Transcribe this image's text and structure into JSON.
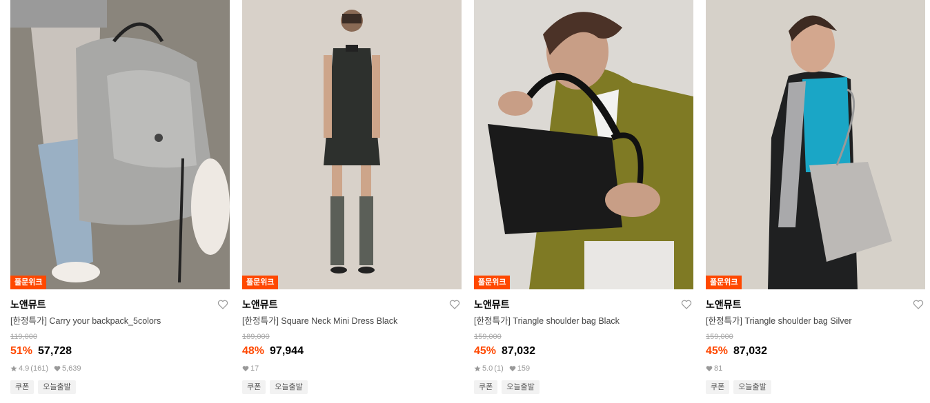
{
  "colors": {
    "accent": "#ff4800",
    "badge_bg": "#ff4800",
    "tag_bg": "#f2f2f2"
  },
  "products": [
    {
      "image_alt": "backpack photo",
      "badge": "풀문위크",
      "brand": "노앤뮤트",
      "name": "[한정특가] Carry your backpack_5colors",
      "original_price": "119,000",
      "discount": "51%",
      "price": "57,728",
      "rating": "4.9",
      "review_count": "(161)",
      "likes": "5,639",
      "tags": [
        "쿠폰",
        "오늘출발"
      ]
    },
    {
      "image_alt": "dress photo",
      "badge": "풀문위크",
      "brand": "노앤뮤트",
      "name": "[한정특가] Square Neck Mini Dress Black",
      "original_price": "189,000",
      "discount": "48%",
      "price": "97,944",
      "rating": "",
      "review_count": "",
      "likes": "17",
      "tags": [
        "쿠폰",
        "오늘출발"
      ]
    },
    {
      "image_alt": "black bag photo",
      "badge": "풀문위크",
      "brand": "노앤뮤트",
      "name": "[한정특가] Triangle shoulder bag Black",
      "original_price": "159,000",
      "discount": "45%",
      "price": "87,032",
      "rating": "5.0",
      "review_count": "(1)",
      "likes": "159",
      "tags": [
        "쿠폰",
        "오늘출발"
      ]
    },
    {
      "image_alt": "silver bag photo",
      "badge": "풀문위크",
      "brand": "노앤뮤트",
      "name": "[한정특가] Triangle shoulder bag Silver",
      "original_price": "159,000",
      "discount": "45%",
      "price": "87,032",
      "rating": "",
      "review_count": "",
      "likes": "81",
      "tags": [
        "쿠폰",
        "오늘출발"
      ]
    }
  ]
}
